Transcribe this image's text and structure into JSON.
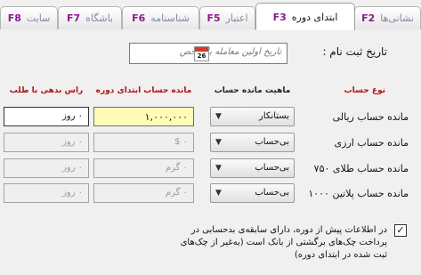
{
  "tabs": [
    {
      "key": "F2",
      "label": "نشانی‌ها",
      "active": false
    },
    {
      "key": "F3",
      "label": "ابتدای دوره",
      "active": true
    },
    {
      "key": "F5",
      "label": "اعتبار",
      "active": false
    },
    {
      "key": "F6",
      "label": "شناسنامه",
      "active": false
    },
    {
      "key": "F7",
      "label": "باشگاه",
      "active": false
    },
    {
      "key": "F8",
      "label": "سایت",
      "active": false
    }
  ],
  "register_date": {
    "label": "تاریخ ثبت نام :",
    "placeholder": "تاریخ اولین معامله با شخص",
    "calendar_icon_day": "26"
  },
  "table": {
    "headers": {
      "account_type": "نوع حساب",
      "balance_nature": "ماهیت مانده حساب",
      "opening_balance": "مانده حساب ابتدای دوره",
      "due_days": "راس بدهی با طلب"
    },
    "rows": [
      {
        "label": "مانده حساب ریالی",
        "nature": "بستانکار",
        "amount": "۱,۰۰۰,۰۰۰",
        "days": "۰ روز",
        "enabled": true
      },
      {
        "label": "مانده حساب ارزی",
        "nature": "بی‌حساب",
        "amount": "۰ $",
        "days": "۰ روز",
        "enabled": false
      },
      {
        "label": "مانده حساب طلای ۷۵۰",
        "nature": "بی‌حساب",
        "amount": "۰ گرم",
        "days": "۰ روز",
        "enabled": false
      },
      {
        "label": "مانده حساب پلاتین ۱۰۰۰",
        "nature": "بی‌حساب",
        "amount": "۰ گرم",
        "days": "۰ روز",
        "enabled": false
      }
    ]
  },
  "option_checkbox": {
    "checked": true,
    "label": "در اطلاعات پیش از دوره، دارای سابقه‌ی بدحسابی در پرداخت چک‌های برگشتی از بانک است (به‌غیر از چک‌های ثبت شده در ابتدای دوره)"
  },
  "colors": {
    "header_red": "#b01515",
    "highlight_field": "#fffcb8",
    "tab_key": "#8b1a8b"
  }
}
